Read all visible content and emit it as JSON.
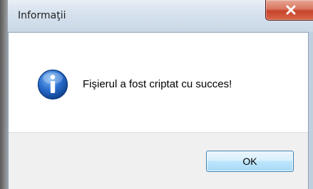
{
  "window": {
    "title": "Informaţii",
    "close_label": "x"
  },
  "dialog": {
    "icon": "information-icon",
    "message": "Fişierul a fost criptat cu succes!",
    "ok_label": "OK"
  },
  "colors": {
    "icon_blue": "#1c5fb8",
    "close_red": "#c7442a",
    "button_border": "#3c7fb1",
    "footer_bg": "#f0f0f0"
  }
}
